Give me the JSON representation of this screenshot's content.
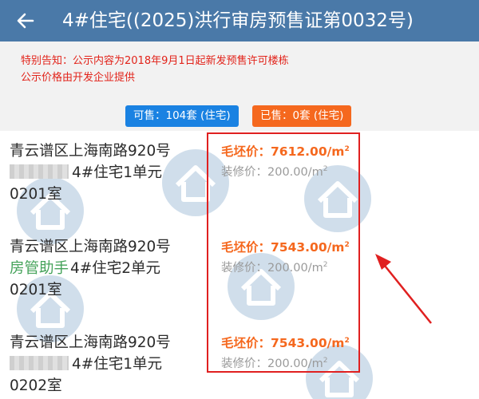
{
  "header": {
    "back_icon": "arrow-left-icon",
    "title": "4#住宅((2025)洪行审房预售证第0032号)"
  },
  "notice": {
    "line1": "特别告知：公示内容为2018年9月1日起新发预售许可楼栋",
    "line2": "公示价格由开发企业提供"
  },
  "stats": {
    "available": "可售：104套 (住宅)",
    "sold": "已售：0套 (住宅)",
    "available_color": "#1a82e2",
    "sold_color": "#f5681e"
  },
  "units": [
    {
      "addr_line1": "青云谱区上海南路920号",
      "addr_prefix": "",
      "addr_line2_rest": "4#住宅1单元",
      "addr_line3": "0201室",
      "raw_label": "毛坯价：",
      "raw_price": "7612.00/m",
      "deco_label": "装修价：",
      "deco_price": "200.00/m"
    },
    {
      "addr_line1": "青云谱区上海南路920号",
      "addr_prefix": "房管助手",
      "addr_line2_rest": "4#住宅2单元",
      "addr_line3": "0201室",
      "raw_label": "毛坯价：",
      "raw_price": "7543.00/m",
      "deco_label": "装修价：",
      "deco_price": "200.00/m"
    },
    {
      "addr_line1": "青云谱区上海南路920号",
      "addr_prefix": "",
      "addr_line2_rest": "4#住宅1单元",
      "addr_line3": "0202室",
      "raw_label": "毛坯价：",
      "raw_price": "7543.00/m",
      "deco_label": "装修价：",
      "deco_price": "200.00/m"
    }
  ],
  "unit_superscript": "2",
  "annotation": {
    "box_color": "#e02020",
    "arrow_icon": "red-arrow-icon"
  }
}
